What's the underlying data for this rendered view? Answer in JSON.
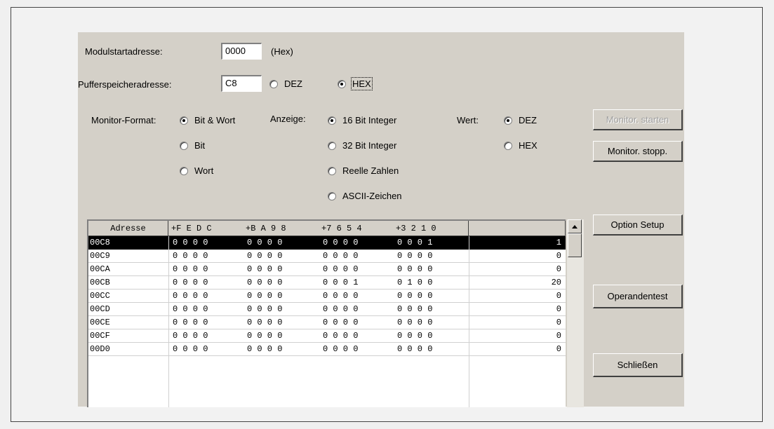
{
  "form": {
    "module_start_label": "Modulstartadresse:",
    "module_start_value": "0000",
    "module_start_unit": "(Hex)",
    "buffer_label": "Pufferspeicheradresse:",
    "buffer_value": "C8",
    "radix_dez": "DEZ",
    "radix_hex": "HEX",
    "radix_selected": "HEX"
  },
  "monitor_format": {
    "label": "Monitor-Format:",
    "options": [
      "Bit & Wort",
      "Bit",
      "Wort"
    ],
    "selected": "Bit & Wort"
  },
  "anzeige": {
    "label": "Anzeige:",
    "options": [
      "16 Bit Integer",
      "32 Bit Integer",
      "Reelle Zahlen",
      "ASCII-Zeichen"
    ],
    "selected": "16 Bit Integer"
  },
  "wert": {
    "label": "Wert:",
    "options": [
      "DEZ",
      "HEX"
    ],
    "selected": "DEZ"
  },
  "buttons": {
    "monitor_start": "Monitor. starten",
    "monitor_stop": "Monitor. stopp.",
    "option_setup": "Option Setup",
    "operandentest": "Operandentest",
    "schliessen": "Schließen"
  },
  "table": {
    "headers": [
      "Adresse",
      "+F E D C",
      "+B A 9 8",
      "+7 6 5 4",
      "+3 2 1 0",
      ""
    ],
    "selected_row": 0,
    "rows": [
      {
        "addr": "00C8",
        "g1": "0 0 0 0",
        "g2": "0 0 0 0",
        "g3": "0 0 0 0",
        "g4": "0 0 0 1",
        "val": "1"
      },
      {
        "addr": "00C9",
        "g1": "0 0 0 0",
        "g2": "0 0 0 0",
        "g3": "0 0 0 0",
        "g4": "0 0 0 0",
        "val": "0"
      },
      {
        "addr": "00CA",
        "g1": "0 0 0 0",
        "g2": "0 0 0 0",
        "g3": "0 0 0 0",
        "g4": "0 0 0 0",
        "val": "0"
      },
      {
        "addr": "00CB",
        "g1": "0 0 0 0",
        "g2": "0 0 0 0",
        "g3": "0 0 0 1",
        "g4": "0 1 0 0",
        "val": "20"
      },
      {
        "addr": "00CC",
        "g1": "0 0 0 0",
        "g2": "0 0 0 0",
        "g3": "0 0 0 0",
        "g4": "0 0 0 0",
        "val": "0"
      },
      {
        "addr": "00CD",
        "g1": "0 0 0 0",
        "g2": "0 0 0 0",
        "g3": "0 0 0 0",
        "g4": "0 0 0 0",
        "val": "0"
      },
      {
        "addr": "00CE",
        "g1": "0 0 0 0",
        "g2": "0 0 0 0",
        "g3": "0 0 0 0",
        "g4": "0 0 0 0",
        "val": "0"
      },
      {
        "addr": "00CF",
        "g1": "0 0 0 0",
        "g2": "0 0 0 0",
        "g3": "0 0 0 0",
        "g4": "0 0 0 0",
        "val": "0"
      },
      {
        "addr": "00D0",
        "g1": "0 0 0 0",
        "g2": "0 0 0 0",
        "g3": "0 0 0 0",
        "g4": "0 0 0 0",
        "val": "0"
      }
    ]
  },
  "icons": {
    "scroll_up": "triangle-up-icon",
    "radio_on": "radio-checked-icon",
    "radio_off": "radio-unchecked-icon"
  }
}
